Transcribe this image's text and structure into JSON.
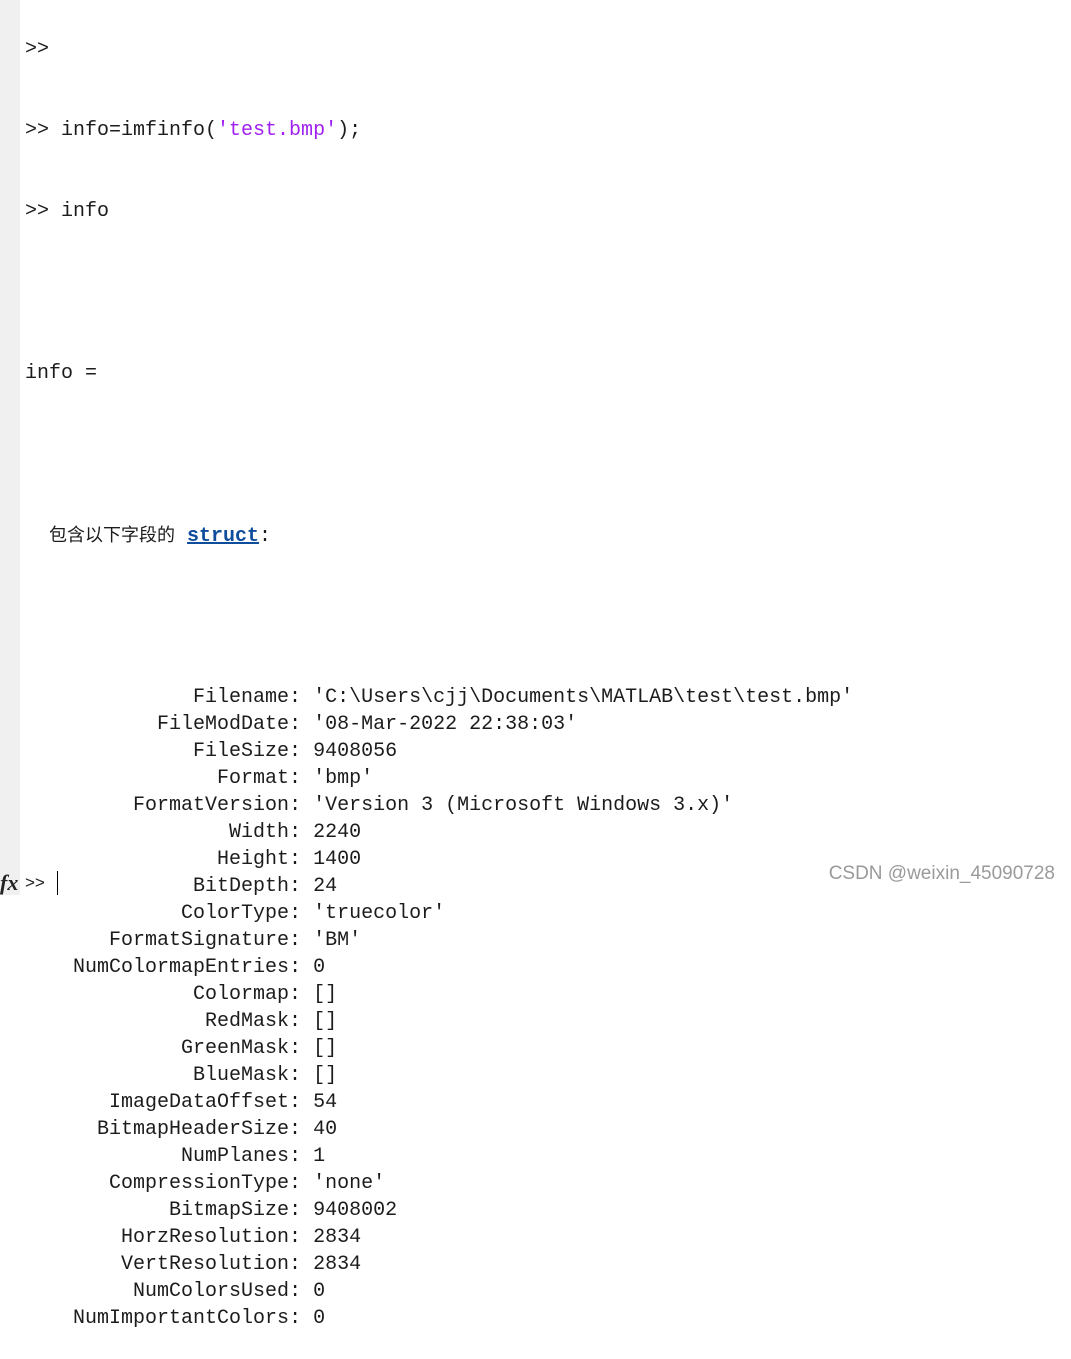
{
  "console": {
    "prev_prompt": ">>",
    "cmd1": {
      "prompt": ">> ",
      "pre": "info=imfinfo(",
      "str": "'test.bmp'",
      "post": ");"
    },
    "cmd2": {
      "prompt": ">> ",
      "text": "info"
    },
    "var_header": "info =",
    "struct_intro": "包含以下字段的",
    "struct_link": "struct",
    "struct_colon": ":",
    "fields": [
      {
        "name": "Filename",
        "value": "'C:\\Users\\cjj\\Documents\\MATLAB\\test\\test.bmp'"
      },
      {
        "name": "FileModDate",
        "value": "'08-Mar-2022 22:38:03'"
      },
      {
        "name": "FileSize",
        "value": "9408056"
      },
      {
        "name": "Format",
        "value": "'bmp'"
      },
      {
        "name": "FormatVersion",
        "value": "'Version 3 (Microsoft Windows 3.x)'"
      },
      {
        "name": "Width",
        "value": "2240"
      },
      {
        "name": "Height",
        "value": "1400"
      },
      {
        "name": "BitDepth",
        "value": "24"
      },
      {
        "name": "ColorType",
        "value": "'truecolor'"
      },
      {
        "name": "FormatSignature",
        "value": "'BM'"
      },
      {
        "name": "NumColormapEntries",
        "value": "0"
      },
      {
        "name": "Colormap",
        "value": "[]"
      },
      {
        "name": "RedMask",
        "value": "[]"
      },
      {
        "name": "GreenMask",
        "value": "[]"
      },
      {
        "name": "BlueMask",
        "value": "[]"
      },
      {
        "name": "ImageDataOffset",
        "value": "54"
      },
      {
        "name": "BitmapHeaderSize",
        "value": "40"
      },
      {
        "name": "NumPlanes",
        "value": "1"
      },
      {
        "name": "CompressionType",
        "value": "'none'"
      },
      {
        "name": "BitmapSize",
        "value": "9408002"
      },
      {
        "name": "HorzResolution",
        "value": "2834"
      },
      {
        "name": "VertResolution",
        "value": "2834"
      },
      {
        "name": "NumColorsUsed",
        "value": "0"
      },
      {
        "name": "NumImportantColors",
        "value": "0"
      }
    ]
  },
  "prompt": {
    "fx": "fx",
    "symbol": ">>"
  },
  "watermark": "CSDN @weixin_45090728",
  "colors": {
    "string": "#a020f0",
    "link": "#0e4c9c",
    "gutter": "#f0f0f0"
  }
}
